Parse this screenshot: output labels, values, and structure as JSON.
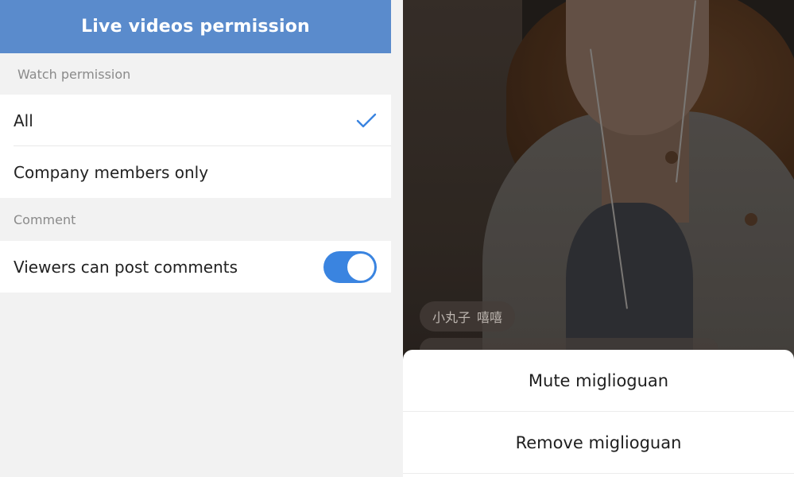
{
  "left": {
    "title": "Live videos permission",
    "watch_section": "Watch permission",
    "watch_options": [
      {
        "label": "All",
        "selected": true
      },
      {
        "label": "Company members only",
        "selected": false
      }
    ],
    "comment_section": "Comment",
    "comment_toggle": {
      "label": "Viewers can post comments",
      "on": true
    }
  },
  "right": {
    "chat_user": "小丸子",
    "chat_text": "嘻嘻",
    "sheet": {
      "mute_label": "Mute miglioguan",
      "remove_label": "Remove miglioguan"
    }
  },
  "colors": {
    "header_bg": "#5a8bcc",
    "accent": "#3a84e0",
    "page_bg": "#f2f2f2"
  },
  "icons": [
    "checkmark-icon",
    "toggle-switch"
  ]
}
